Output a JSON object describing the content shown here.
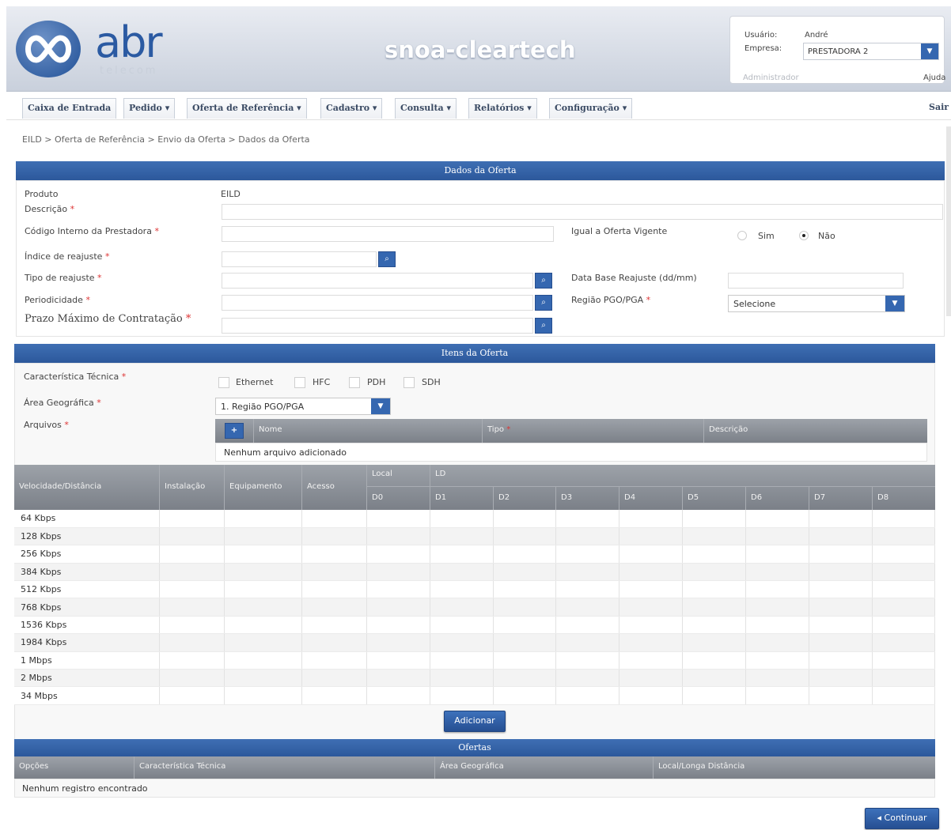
{
  "header": {
    "logo_text": "abr",
    "logo_sub": "telecom",
    "app_title": "snoa-cleartech"
  },
  "user": {
    "user_label": "Usuário:",
    "user_value": "André",
    "company_label": "Empresa:",
    "company_value": "PRESTADORA 2",
    "role": "Administrador",
    "help": "Ajuda"
  },
  "menu": {
    "items": [
      "Caixa de Entrada",
      "Pedido ▾",
      "Oferta de Referência ▾",
      "Cadastro ▾",
      "Consulta ▾",
      "Relatórios ▾",
      "Configuração ▾"
    ],
    "logout": "Sair"
  },
  "breadcrumb": "EILD >  Oferta de Referência >  Envio da Oferta >  Dados da Oferta",
  "dados": {
    "title": "Dados da Oferta",
    "produto_label": "Produto",
    "produto_value": "EILD",
    "descricao_label": "Descrição",
    "codigo_label": "Código Interno da Prestadora",
    "indice_label": "Índice de reajuste",
    "tipo_label": "Tipo de reajuste",
    "periodicidade_label": "Periodicidade",
    "prazo_label": "Prazo Máximo de Contratação",
    "igual_label": "Igual a Oferta Vigente",
    "sim": "Sim",
    "nao": "Não",
    "data_base_label": "Data Base Reajuste (dd/mm)",
    "regiao_label": "Região PGO/PGA",
    "regiao_value": "Selecione",
    "required": "*"
  },
  "itens": {
    "title": "Itens da Oferta",
    "carac_label": "Característica Técnica",
    "options": [
      "Ethernet",
      "HFC",
      "PDH",
      "SDH"
    ],
    "area_label": "Área Geográfica",
    "area_value": "1. Região PGO/PGA",
    "arquivos_label": "Arquivos",
    "files_cols": [
      "Nome",
      "Tipo",
      "Descrição"
    ],
    "no_files": "Nenhum arquivo adicionado",
    "add_icon": "+"
  },
  "grid": {
    "cols": [
      "Velocidade/Distância",
      "Instalação",
      "Equipamento",
      "Acesso"
    ],
    "group_local": "Local",
    "group_ld": "LD",
    "subcols": [
      "D0",
      "D1",
      "D2",
      "D3",
      "D4",
      "D5",
      "D6",
      "D7",
      "D8"
    ],
    "rows": [
      "64 Kbps",
      "128 Kbps",
      "256 Kbps",
      "384 Kbps",
      "512 Kbps",
      "768 Kbps",
      "1536 Kbps",
      "1984 Kbps",
      "1 Mbps",
      "2 Mbps",
      "34 Mbps"
    ]
  },
  "add_button": "Adicionar",
  "ofertas": {
    "title": "Ofertas",
    "cols": [
      "Opções",
      "Característica Técnica",
      "Área Geográfica",
      "Local/Longa Distância"
    ],
    "empty": "Nenhum registro encontrado"
  },
  "continue_button": "Continuar",
  "continue_icon": "◂"
}
